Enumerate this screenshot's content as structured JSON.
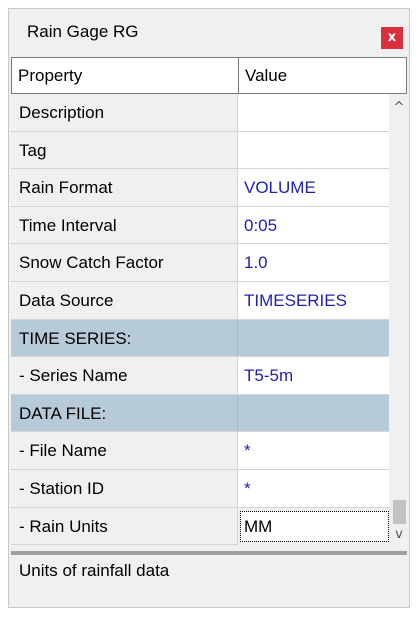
{
  "window": {
    "title": "Rain Gage RG",
    "close_label": "x"
  },
  "grid": {
    "headers": {
      "property": "Property",
      "value": "Value"
    },
    "rows": [
      {
        "property": "Description",
        "value": "",
        "type": "normal"
      },
      {
        "property": "Tag",
        "value": "",
        "type": "normal"
      },
      {
        "property": "Rain Format",
        "value": "VOLUME",
        "type": "normal"
      },
      {
        "property": "Time Interval",
        "value": "0:05",
        "type": "normal"
      },
      {
        "property": "Snow Catch Factor",
        "value": "1.0",
        "type": "normal"
      },
      {
        "property": "Data Source",
        "value": "TIMESERIES",
        "type": "normal"
      },
      {
        "property": "TIME SERIES:",
        "value": "",
        "type": "section"
      },
      {
        "property": " - Series Name",
        "value": "T5-5m",
        "type": "normal"
      },
      {
        "property": "DATA FILE:",
        "value": "",
        "type": "section"
      },
      {
        "property": " - File Name",
        "value": "*",
        "type": "normal"
      },
      {
        "property": " - Station ID",
        "value": "*",
        "type": "normal"
      },
      {
        "property": " - Rain Units",
        "value": "MM",
        "type": "editing"
      }
    ]
  },
  "scrollbar": {
    "up_icon": "^",
    "down_icon": "v"
  },
  "description_text": "Units of rainfall data",
  "colors": {
    "value_text": "#1f1fb4",
    "section_bg": "#b7cad8",
    "close_bg": "#d9303e"
  }
}
